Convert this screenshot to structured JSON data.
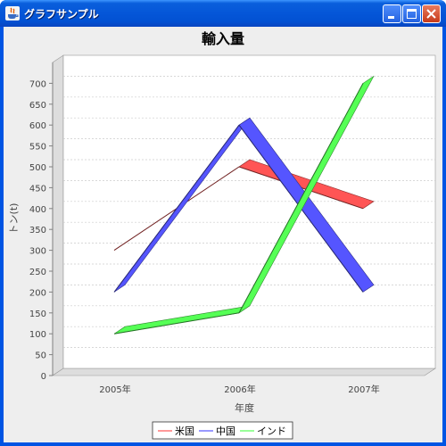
{
  "window": {
    "title": "グラフサンプル",
    "icons": {
      "app": "java-icon",
      "minimize": "minimize-icon",
      "maximize": "maximize-icon",
      "close": "close-icon"
    }
  },
  "chart_data": {
    "type": "line",
    "style": "3d-ribbon",
    "title": "輸入量",
    "xlabel": "年度",
    "ylabel": "トン(t)",
    "categories": [
      "2005年",
      "2006年",
      "2007年"
    ],
    "series": [
      {
        "name": "米国",
        "values": [
          300,
          500,
          400
        ],
        "color": "#ff5555"
      },
      {
        "name": "中国",
        "values": [
          200,
          600,
          200
        ],
        "color": "#5555ff"
      },
      {
        "name": "インド",
        "values": [
          100,
          150,
          700
        ],
        "color": "#55ff55"
      }
    ],
    "yticks": [
      0,
      50,
      100,
      150,
      200,
      250,
      300,
      350,
      400,
      450,
      500,
      550,
      600,
      650,
      700
    ],
    "ylim": [
      0,
      750
    ],
    "grid": true,
    "legend": "bottom"
  }
}
